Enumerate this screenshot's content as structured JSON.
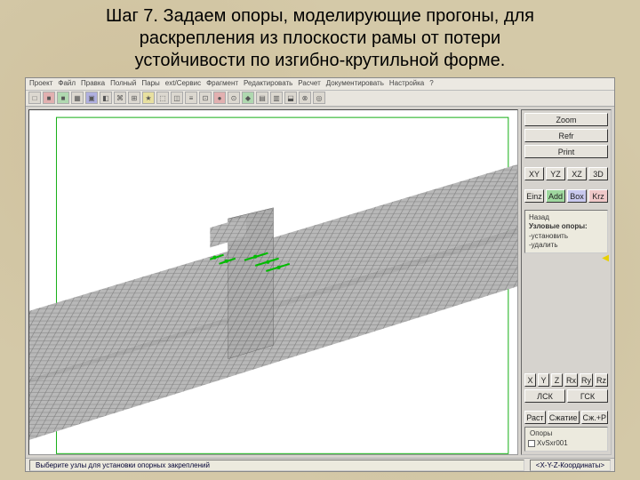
{
  "slide": {
    "title_l1": "Шаг 7. Задаем опоры, моделирующие прогоны, для",
    "title_l2": "раскрепления из плоскости рамы от потери",
    "title_l3": "устойчивости по изгибно-крутильной форме."
  },
  "menu": [
    "Проект",
    "Файл",
    "Правка",
    "Полный",
    "Пары",
    "ext/Сервис",
    "Фрагмент",
    "Редактировать",
    "Расчет",
    "Документировать",
    "Настройка",
    "?"
  ],
  "side": {
    "zoom": "Zoom",
    "refr": "Refr",
    "print": "Print",
    "views": [
      "XY",
      "YZ",
      "XZ",
      "3D"
    ],
    "sel": [
      "Einz",
      "Add",
      "Box",
      "Krz"
    ],
    "back": "Назад",
    "panel_hdr": "Узловые опоры:",
    "panel_i1": "-установить",
    "panel_i2": "-удалить",
    "dof": [
      "X",
      "Y",
      "Z",
      "Rx",
      "Ry",
      "Rz"
    ],
    "coord1": "ЛСК",
    "coord2": "ГСК",
    "load": [
      "Раст",
      "Сжатие",
      "Сж.+Р"
    ],
    "out_lbl": "Опоры",
    "out_val": "XvSxr001"
  },
  "status": {
    "msg": "Выберите узлы для установки опорных закреплений",
    "coord": "<X-Y-Z-Координаты>"
  }
}
